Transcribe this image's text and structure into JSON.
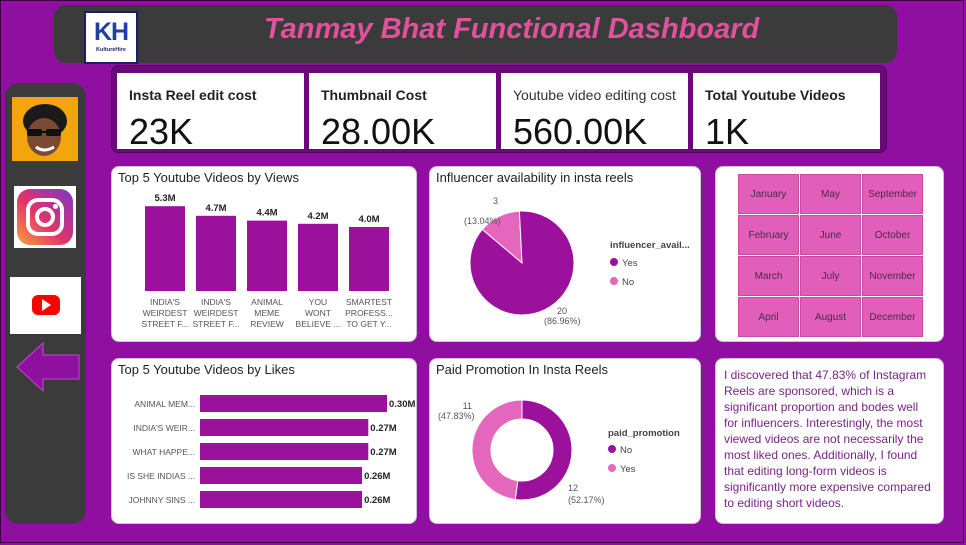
{
  "header": {
    "title": "Tanmay Bhat Functional Dashboard",
    "logo_text": "KH",
    "logo_subtext": "KultureHire"
  },
  "sidebar": {
    "icons": [
      "avatar",
      "instagram-icon",
      "youtube-icon",
      "back-arrow-icon"
    ]
  },
  "kpis": [
    {
      "label": "Insta Reel edit cost",
      "value": "23K"
    },
    {
      "label": "Thumbnail Cost",
      "value": "28.00K"
    },
    {
      "label": "Youtube video editing cost",
      "value": "560.00K"
    },
    {
      "label": "Total Youtube Videos",
      "value": "1K"
    }
  ],
  "views_chart": {
    "title": "Top 5 Youtube Videos by Views",
    "chart_data": {
      "type": "bar",
      "categories": [
        [
          "INDIA'S",
          "WEIRDEST",
          "STREET F..."
        ],
        [
          "INDIA'S",
          "WEIRDEST",
          "STREET F..."
        ],
        [
          "ANIMAL",
          "MEME",
          "REVIEW"
        ],
        [
          "YOU",
          "WONT",
          "BELIEVE ..."
        ],
        [
          "SMARTEST",
          "PROFESS...",
          "TO GET Y..."
        ]
      ],
      "values": [
        5.3,
        4.7,
        4.4,
        4.2,
        4.0
      ],
      "labels": [
        "5.3M",
        "4.7M",
        "4.4M",
        "4.2M",
        "4.0M"
      ],
      "ylim": [
        0,
        5.5
      ],
      "color": "#9b119c"
    }
  },
  "likes_chart": {
    "title": "Top 5 Youtube Videos by Likes",
    "chart_data": {
      "type": "bar",
      "orientation": "horizontal",
      "categories": [
        "ANIMAL MEM...",
        "INDIA'S WEIR...",
        "WHAT HAPPE...",
        "IS SHE INDIAS ...",
        "JOHNNY SINS ..."
      ],
      "values": [
        0.3,
        0.27,
        0.27,
        0.26,
        0.26
      ],
      "labels": [
        "0.30M",
        "0.27M",
        "0.27M",
        "0.26M",
        "0.26M"
      ],
      "xlim": [
        0,
        0.3
      ],
      "color": "#9b119c"
    }
  },
  "influencer_chart": {
    "title": "Influencer availability in insta reels",
    "legend_title": "influencer_avail...",
    "chart_data": {
      "type": "pie",
      "slices": [
        {
          "name": "Yes",
          "value": 20,
          "pct": "(86.96%)",
          "color": "#9b119c"
        },
        {
          "name": "No",
          "value": 3,
          "pct": "(13.04%)",
          "color": "#e466bd"
        }
      ]
    }
  },
  "promotion_chart": {
    "title": "Paid Promotion In Insta Reels",
    "legend_title": "paid_promotion",
    "chart_data": {
      "type": "pie",
      "donut": true,
      "slices": [
        {
          "name": "No",
          "value": 12,
          "pct": "(52.17%)",
          "color": "#9b119c"
        },
        {
          "name": "Yes",
          "value": 11,
          "pct": "(47.83%)",
          "color": "#e466bd"
        }
      ]
    }
  },
  "months": [
    "January",
    "May",
    "September",
    "February",
    "June",
    "October",
    "March",
    "July",
    "November",
    "April",
    "August",
    "December"
  ],
  "insight": "I discovered that 47.83% of Instagram Reels are sponsored, which is a significant proportion and bodes well for influencers. Interestingly, the most viewed videos are not necessarily the most liked ones. Additionally, I found that editing long-form videos is significantly more expensive compared to editing short videos."
}
